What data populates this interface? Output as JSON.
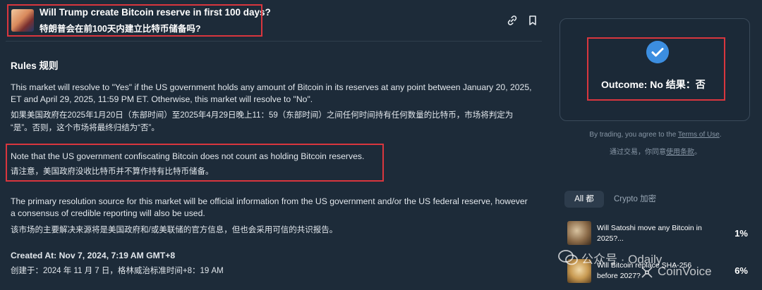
{
  "header": {
    "title_en": "Will Trump create Bitcoin reserve in first 100 days?",
    "title_zh": "特朗普会在前100天内建立比特币储备吗?"
  },
  "rules": {
    "heading": "Rules  规则",
    "p1_en_line1": "This market will resolve to \"Yes\" if the US government holds any amount of Bitcoin in its reserves at any point between January 20, 2025,",
    "p1_en_line2": "ET and April 29, 2025, 11:59 PM ET. Otherwise, this market will resolve to \"No\".",
    "p1_zh_line1": "如果美国政府在2025年1月20日（东部时间）至2025年4月29日晚上11：59（东部时间）之间任何时间持有任何数量的比特币，市场将判定为",
    "p1_zh_line2": "“是”。否则，这个市场将最终归结为“否”。",
    "note_en": "Note that the US government confiscating Bitcoin does not count as holding Bitcoin reserves.",
    "note_zh": "请注意，美国政府没收比特币并不算作持有比特币储备。",
    "p3_en_line1": "The primary resolution source for this market will be official information from the US government and/or the US federal reserve, however",
    "p3_en_line2": "a consensus of credible reporting will also be used.",
    "p3_zh": "该市场的主要解决来源将是美国政府和/或美联储的官方信息，但也会采用可信的共识报告。",
    "created_en": "Created At: Nov 7, 2024, 7:19 AM GMT+8",
    "created_zh": "创建于：2024 年 11 月 7 日，格林威治标准时间+8：19 AM"
  },
  "outcome": {
    "text": "Outcome: No  结果：否",
    "check_color": "#3c8ee0"
  },
  "terms": {
    "en_prefix": "By trading, you agree to the ",
    "en_link": "Terms of Use",
    "en_suffix": ".",
    "zh_prefix": "通过交易，你同意",
    "zh_link": "使用条款",
    "zh_suffix": "。"
  },
  "tabs": {
    "all": "All  都",
    "crypto": "Crypto  加密"
  },
  "markets": [
    {
      "title_line1": "Will Satoshi move any Bitcoin in",
      "title_line2": "2025?...",
      "pct": "1%"
    },
    {
      "title_line1": "Will Bitcoin replace SHA-256",
      "title_line2": "before 2027?",
      "pct": "6%"
    }
  ],
  "watermark": {
    "left": "公众号 · Odaily",
    "right": "CoinVoice"
  },
  "colors": {
    "background": "#1d2b39",
    "highlight_box": "#d9363e",
    "accent": "#3c8ee0"
  }
}
